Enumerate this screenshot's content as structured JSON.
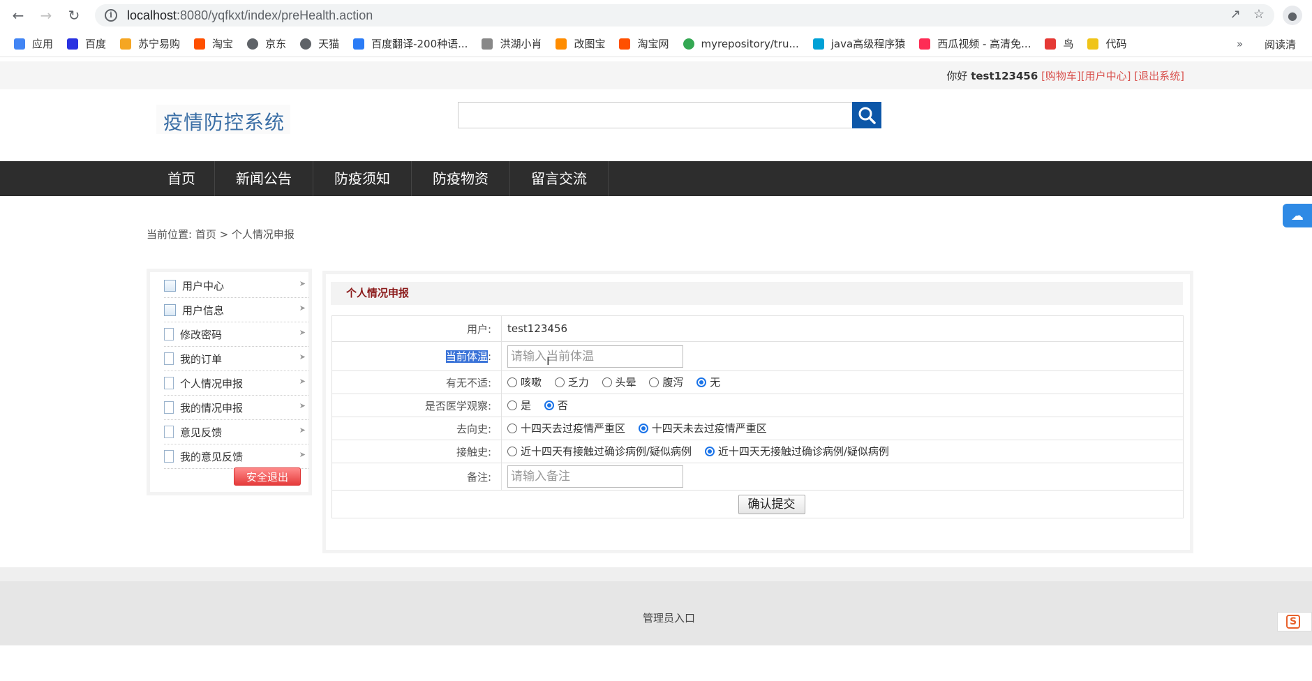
{
  "browser": {
    "url_host": "localhost",
    "url_rest": ":8080/yqfkxt/index/preHealth.action",
    "bookmarks": [
      {
        "label": "应用",
        "icon": "apps-grid-icon",
        "color": "#4285f4"
      },
      {
        "label": "百度",
        "icon": "baidu-paw-icon",
        "color": "#2932e1"
      },
      {
        "label": "苏宁易购",
        "icon": "suning-icon",
        "color": "#f5a623"
      },
      {
        "label": "淘宝",
        "icon": "taobao-icon",
        "color": "#ff5000"
      },
      {
        "label": "京东",
        "icon": "globe-icon",
        "color": "#5f6368"
      },
      {
        "label": "天猫",
        "icon": "globe-icon",
        "color": "#5f6368"
      },
      {
        "label": "百度翻译-200种语...",
        "icon": "translate-icon",
        "color": "#2b7cf6"
      },
      {
        "label": "洪湖小肖",
        "icon": "bird-icon",
        "color": "#888888"
      },
      {
        "label": "改图宝",
        "icon": "gaitubao-icon",
        "color": "#ff8c00"
      },
      {
        "label": "淘宝网",
        "icon": "taobao-icon",
        "color": "#ff5000"
      },
      {
        "label": "myrepository/tru...",
        "icon": "chrome-icon",
        "color": "#34a853"
      },
      {
        "label": "java高级程序猿",
        "icon": "bilibili-icon",
        "color": "#00a1d6"
      },
      {
        "label": "西瓜视频 - 高清免...",
        "icon": "xigua-icon",
        "color": "#fe2c55"
      },
      {
        "label": "鸟",
        "icon": "bird-red-icon",
        "color": "#e53935"
      },
      {
        "label": "代码",
        "icon": "leaf-icon",
        "color": "#f0c419"
      }
    ],
    "bookmarks_more": "»",
    "reader_label": "阅读清"
  },
  "userbar": {
    "greeting": "你好",
    "username": "test123456",
    "links": [
      "[购物车]",
      "[用户中心]",
      "[退出系统]"
    ]
  },
  "site": {
    "logo_text": "疫情防控系统",
    "search_placeholder": ""
  },
  "nav": [
    "首页",
    "新闻公告",
    "防疫须知",
    "防疫物资",
    "留言交流"
  ],
  "breadcrumb": "当前位置: 首页 > 个人情况申报",
  "sidebar": {
    "items": [
      {
        "label": "用户中心",
        "icon": "card-icon"
      },
      {
        "label": "用户信息",
        "icon": "card-icon"
      },
      {
        "label": "修改密码",
        "icon": "doc-icon"
      },
      {
        "label": "我的订单",
        "icon": "doc-icon"
      },
      {
        "label": "个人情况申报",
        "icon": "doc-icon"
      },
      {
        "label": "我的情况申报",
        "icon": "doc-icon"
      },
      {
        "label": "意见反馈",
        "icon": "doc-icon"
      },
      {
        "label": "我的意见反馈",
        "icon": "doc-icon"
      }
    ],
    "logout": "安全退出"
  },
  "form": {
    "title": "个人情况申报",
    "user_label": "用户:",
    "user_value": "test123456",
    "temp_label_hl": "当前体温",
    "temp_label_colon": ":",
    "temp_placeholder": "请输入当前体温",
    "symptom_label": "有无不适:",
    "symptom_options": [
      "咳嗽",
      "乏力",
      "头晕",
      "腹泻",
      "无"
    ],
    "symptom_selected": "无",
    "observe_label": "是否医学观察:",
    "observe_options": [
      "是",
      "否"
    ],
    "observe_selected": "否",
    "travel_label": "去向史:",
    "travel_options": [
      "十四天去过疫情严重区",
      "十四天未去过疫情严重区"
    ],
    "travel_selected": "十四天未去过疫情严重区",
    "contact_label": "接触史:",
    "contact_options": [
      "近十四天有接触过确诊病例/疑似病例",
      "近十四天无接触过确诊病例/疑似病例"
    ],
    "contact_selected": "近十四天无接触过确诊病例/疑似病例",
    "note_label": "备注:",
    "note_placeholder": "请输入备注",
    "submit": "确认提交"
  },
  "footer": {
    "admin_link": "管理员入口"
  },
  "colors": {
    "nav_bg": "#2d2d2d",
    "accent_blue": "#0d57a8",
    "title_red": "#8b1a1a",
    "link_red": "#d9534f"
  }
}
